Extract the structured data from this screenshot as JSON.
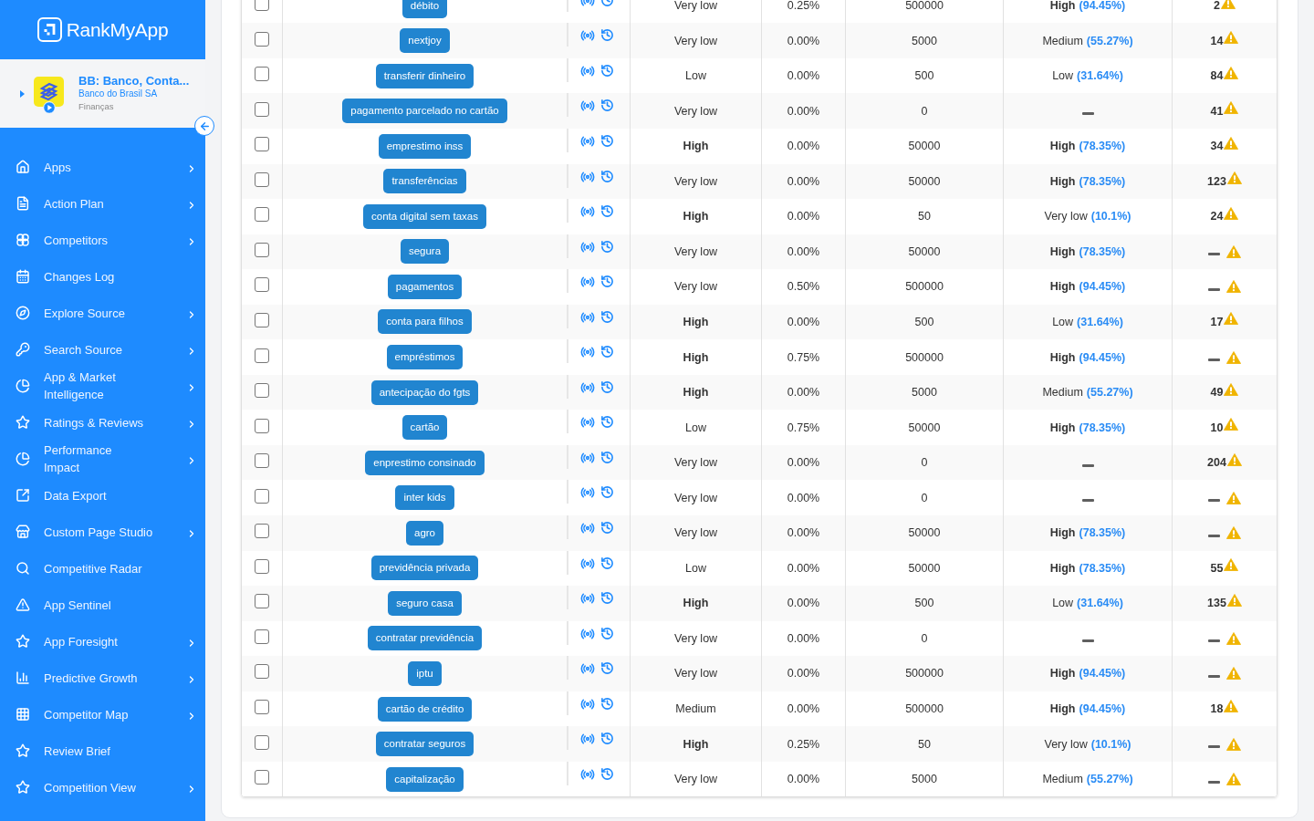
{
  "sidebar": {
    "logo": "RankMyApp",
    "app": {
      "title": "BB: Banco, Conta...",
      "publisher": "Banco do Brasil SA",
      "category": "Finanças"
    },
    "items": [
      {
        "label": "Apps",
        "expandable": true
      },
      {
        "label": "Action Plan",
        "expandable": true
      },
      {
        "label": "Competitors",
        "expandable": true
      },
      {
        "label": "Changes Log",
        "expandable": false
      },
      {
        "label": "Explore Source",
        "expandable": true
      },
      {
        "label": "Search Source",
        "expandable": true
      },
      {
        "label": "App & Market\nIntelligence",
        "expandable": true
      },
      {
        "label": "Ratings & Reviews",
        "expandable": true
      },
      {
        "label": "Performance\nImpact",
        "expandable": true
      },
      {
        "label": "Data Export",
        "expandable": false
      },
      {
        "label": "Custom Page Studio",
        "expandable": true
      },
      {
        "label": "Competitive Radar",
        "expandable": false
      },
      {
        "label": "App Sentinel",
        "expandable": false
      },
      {
        "label": "App Foresight",
        "expandable": true
      },
      {
        "label": "Predictive Growth",
        "expandable": true
      },
      {
        "label": "Competitor Map",
        "expandable": true
      },
      {
        "label": "Review Brief",
        "expandable": false
      },
      {
        "label": "Competition View",
        "expandable": true
      }
    ]
  },
  "table": {
    "rows": [
      {
        "checked": false,
        "tag": "débito",
        "column_4": {
          "label": "Very low",
          "strong": false
        },
        "column_5": "0.25%",
        "column_6": "500000",
        "column_7": {
          "kind": "value",
          "label": "High",
          "strong": true,
          "percentage": "(94.45%)"
        },
        "column_8": {
          "kind": "value",
          "value": "2"
        }
      },
      {
        "checked": false,
        "tag": "nextjoy",
        "column_4": {
          "label": "Very low",
          "strong": false
        },
        "column_5": "0.00%",
        "column_6": "5000",
        "column_7": {
          "kind": "value",
          "label": "Medium",
          "strong": false,
          "percentage": "(55.27%)"
        },
        "column_8": {
          "kind": "value",
          "value": "14"
        }
      },
      {
        "checked": false,
        "tag": "transferir dinheiro",
        "column_4": {
          "label": "Low",
          "strong": false
        },
        "column_5": "0.00%",
        "column_6": "500",
        "column_7": {
          "kind": "value",
          "label": "Low",
          "strong": false,
          "percentage": "(31.64%)"
        },
        "column_8": {
          "kind": "value",
          "value": "84"
        }
      },
      {
        "checked": false,
        "tag": "pagamento parcelado no cartão",
        "column_4": {
          "label": "Very low",
          "strong": false
        },
        "column_5": "0.00%",
        "column_6": "0",
        "column_7": {
          "kind": "empty"
        },
        "column_8": {
          "kind": "value",
          "value": "41"
        }
      },
      {
        "checked": false,
        "tag": "emprestimo inss",
        "column_4": {
          "label": "High",
          "strong": true
        },
        "column_5": "0.00%",
        "column_6": "50000",
        "column_7": {
          "kind": "value",
          "label": "High",
          "strong": true,
          "percentage": "(78.35%)"
        },
        "column_8": {
          "kind": "value",
          "value": "34"
        }
      },
      {
        "checked": false,
        "tag": "transferências",
        "column_4": {
          "label": "Very low",
          "strong": false
        },
        "column_5": "0.00%",
        "column_6": "50000",
        "column_7": {
          "kind": "value",
          "label": "High",
          "strong": true,
          "percentage": "(78.35%)"
        },
        "column_8": {
          "kind": "value",
          "value": "123"
        }
      },
      {
        "checked": false,
        "tag": "conta digital sem taxas",
        "column_4": {
          "label": "High",
          "strong": true
        },
        "column_5": "0.00%",
        "column_6": "50",
        "column_7": {
          "kind": "value",
          "label": "Very low",
          "strong": false,
          "percentage": "(10.1%)"
        },
        "column_8": {
          "kind": "value",
          "value": "24"
        }
      },
      {
        "checked": false,
        "tag": "segura",
        "column_4": {
          "label": "Very low",
          "strong": false
        },
        "column_5": "0.00%",
        "column_6": "50000",
        "column_7": {
          "kind": "value",
          "label": "High",
          "strong": true,
          "percentage": "(78.35%)"
        },
        "column_8": {
          "kind": "empty"
        }
      },
      {
        "checked": false,
        "tag": "pagamentos",
        "column_4": {
          "label": "Very low",
          "strong": false
        },
        "column_5": "0.50%",
        "column_6": "500000",
        "column_7": {
          "kind": "value",
          "label": "High",
          "strong": true,
          "percentage": "(94.45%)"
        },
        "column_8": {
          "kind": "empty"
        }
      },
      {
        "checked": false,
        "tag": "conta para filhos",
        "column_4": {
          "label": "High",
          "strong": true
        },
        "column_5": "0.00%",
        "column_6": "500",
        "column_7": {
          "kind": "value",
          "label": "Low",
          "strong": false,
          "percentage": "(31.64%)"
        },
        "column_8": {
          "kind": "value",
          "value": "17"
        }
      },
      {
        "checked": false,
        "tag": "empréstimos",
        "column_4": {
          "label": "High",
          "strong": true
        },
        "column_5": "0.75%",
        "column_6": "500000",
        "column_7": {
          "kind": "value",
          "label": "High",
          "strong": true,
          "percentage": "(94.45%)"
        },
        "column_8": {
          "kind": "empty"
        }
      },
      {
        "checked": false,
        "tag": "antecipação do fgts",
        "column_4": {
          "label": "High",
          "strong": true
        },
        "column_5": "0.00%",
        "column_6": "5000",
        "column_7": {
          "kind": "value",
          "label": "Medium",
          "strong": false,
          "percentage": "(55.27%)"
        },
        "column_8": {
          "kind": "value",
          "value": "49"
        }
      },
      {
        "checked": false,
        "tag": "cartão",
        "column_4": {
          "label": "Low",
          "strong": false
        },
        "column_5": "0.75%",
        "column_6": "50000",
        "column_7": {
          "kind": "value",
          "label": "High",
          "strong": true,
          "percentage": "(78.35%)"
        },
        "column_8": {
          "kind": "value",
          "value": "10"
        }
      },
      {
        "checked": false,
        "tag": "enprestimo consinado",
        "column_4": {
          "label": "Very low",
          "strong": false
        },
        "column_5": "0.00%",
        "column_6": "0",
        "column_7": {
          "kind": "empty"
        },
        "column_8": {
          "kind": "value",
          "value": "204"
        }
      },
      {
        "checked": false,
        "tag": "inter kids",
        "column_4": {
          "label": "Very low",
          "strong": false
        },
        "column_5": "0.00%",
        "column_6": "0",
        "column_7": {
          "kind": "empty"
        },
        "column_8": {
          "kind": "empty"
        }
      },
      {
        "checked": false,
        "tag": "agro",
        "column_4": {
          "label": "Very low",
          "strong": false
        },
        "column_5": "0.00%",
        "column_6": "50000",
        "column_7": {
          "kind": "value",
          "label": "High",
          "strong": true,
          "percentage": "(78.35%)"
        },
        "column_8": {
          "kind": "empty"
        }
      },
      {
        "checked": false,
        "tag": "previdência privada",
        "column_4": {
          "label": "Low",
          "strong": false
        },
        "column_5": "0.00%",
        "column_6": "50000",
        "column_7": {
          "kind": "value",
          "label": "High",
          "strong": true,
          "percentage": "(78.35%)"
        },
        "column_8": {
          "kind": "value",
          "value": "55"
        }
      },
      {
        "checked": false,
        "tag": "seguro casa",
        "column_4": {
          "label": "High",
          "strong": true
        },
        "column_5": "0.00%",
        "column_6": "500",
        "column_7": {
          "kind": "value",
          "label": "Low",
          "strong": false,
          "percentage": "(31.64%)"
        },
        "column_8": {
          "kind": "value",
          "value": "135"
        }
      },
      {
        "checked": false,
        "tag": "contratar previdência",
        "column_4": {
          "label": "Very low",
          "strong": false
        },
        "column_5": "0.00%",
        "column_6": "0",
        "column_7": {
          "kind": "empty"
        },
        "column_8": {
          "kind": "empty"
        }
      },
      {
        "checked": false,
        "tag": "iptu",
        "column_4": {
          "label": "Very low",
          "strong": false
        },
        "column_5": "0.00%",
        "column_6": "500000",
        "column_7": {
          "kind": "value",
          "label": "High",
          "strong": true,
          "percentage": "(94.45%)"
        },
        "column_8": {
          "kind": "empty"
        }
      },
      {
        "checked": false,
        "tag": "cartão de crédito",
        "column_4": {
          "label": "Medium",
          "strong": false
        },
        "column_5": "0.00%",
        "column_6": "500000",
        "column_7": {
          "kind": "value",
          "label": "High",
          "strong": true,
          "percentage": "(94.45%)"
        },
        "column_8": {
          "kind": "value",
          "value": "18"
        }
      },
      {
        "checked": false,
        "tag": "contratar seguros",
        "column_4": {
          "label": "High",
          "strong": true
        },
        "column_5": "0.25%",
        "column_6": "50",
        "column_7": {
          "kind": "value",
          "label": "Very low",
          "strong": false,
          "percentage": "(10.1%)"
        },
        "column_8": {
          "kind": "empty"
        }
      },
      {
        "checked": false,
        "tag": "capitalização",
        "column_4": {
          "label": "Very low",
          "strong": false
        },
        "column_5": "0.00%",
        "column_6": "5000",
        "column_7": {
          "kind": "value",
          "label": "Medium",
          "strong": false,
          "percentage": "(55.27%)"
        },
        "column_8": {
          "kind": "empty"
        }
      }
    ]
  }
}
